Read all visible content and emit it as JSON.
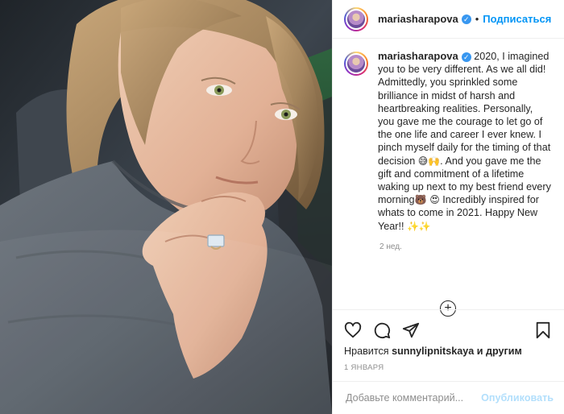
{
  "post": {
    "photo": {
      "description_icon": "selfie-photo"
    },
    "author": {
      "username": "mariasharapova",
      "verified_icon": "verified-badge-icon"
    },
    "header": {
      "separator": "•",
      "follow_label": "Подписаться"
    },
    "caption": {
      "username": "mariasharapova",
      "text_1": "2020, I imagined you to be very different. As we all did! Admittedly, you sprinkled some brilliance in midst of harsh and heartbreaking realities. Personally, you gave me the courage to let go of the one life and career I ever knew. I pinch myself daily for the timing of that decision",
      "emoji_1": "😅🙌",
      "text_2": ". And you gave me the gift and commitment of a lifetime waking up next to my best friend every morning",
      "emoji_2": "🐻 😍",
      "text_3": " Incredibly inspired for whats to come in 2021. Happy New Year!!",
      "emoji_3": "✨✨",
      "time_ago": "2 нед."
    },
    "actions": {
      "like_icon": "heart-icon",
      "comment_icon": "comment-icon",
      "share_icon": "share-icon",
      "save_icon": "bookmark-icon",
      "likes_prefix": "Нравится",
      "likes_user": "sunnylipnitskaya",
      "likes_suffix": "и другим",
      "date": "1 января"
    },
    "add_comment": {
      "placeholder": "Добавьте комментарий...",
      "publish_label": "Опубликовать"
    },
    "colors": {
      "accent": "#0095f6",
      "publish_disabled": "#b2dffc",
      "muted": "#8e8e8e"
    }
  }
}
